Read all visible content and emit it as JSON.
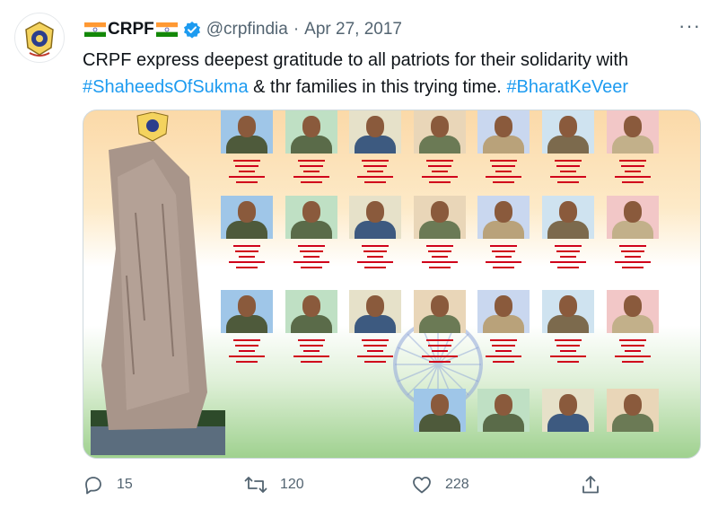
{
  "tweet": {
    "display_name": "CRPF",
    "handle": "@crpfindia",
    "separator": "·",
    "date": "Apr 27, 2017",
    "text_plain_1": "CRPF express deepest gratitude to all patriots for their solidarity with ",
    "hashtag_1": "#ShaheedsOfSukma",
    "text_plain_2": " & thr families in this trying time. ",
    "hashtag_2": "#BharatKeVeer",
    "more": "···"
  },
  "colors": {
    "accent": "#1d9bf0",
    "muted": "#536471",
    "caption_red": "#d0021b"
  },
  "actions": {
    "reply_count": "15",
    "retweet_count": "120",
    "like_count": "228"
  },
  "icons": [
    "flag-india-icon",
    "verified-badge-icon",
    "more-options-icon",
    "reply-icon",
    "retweet-icon",
    "like-icon",
    "share-icon"
  ]
}
